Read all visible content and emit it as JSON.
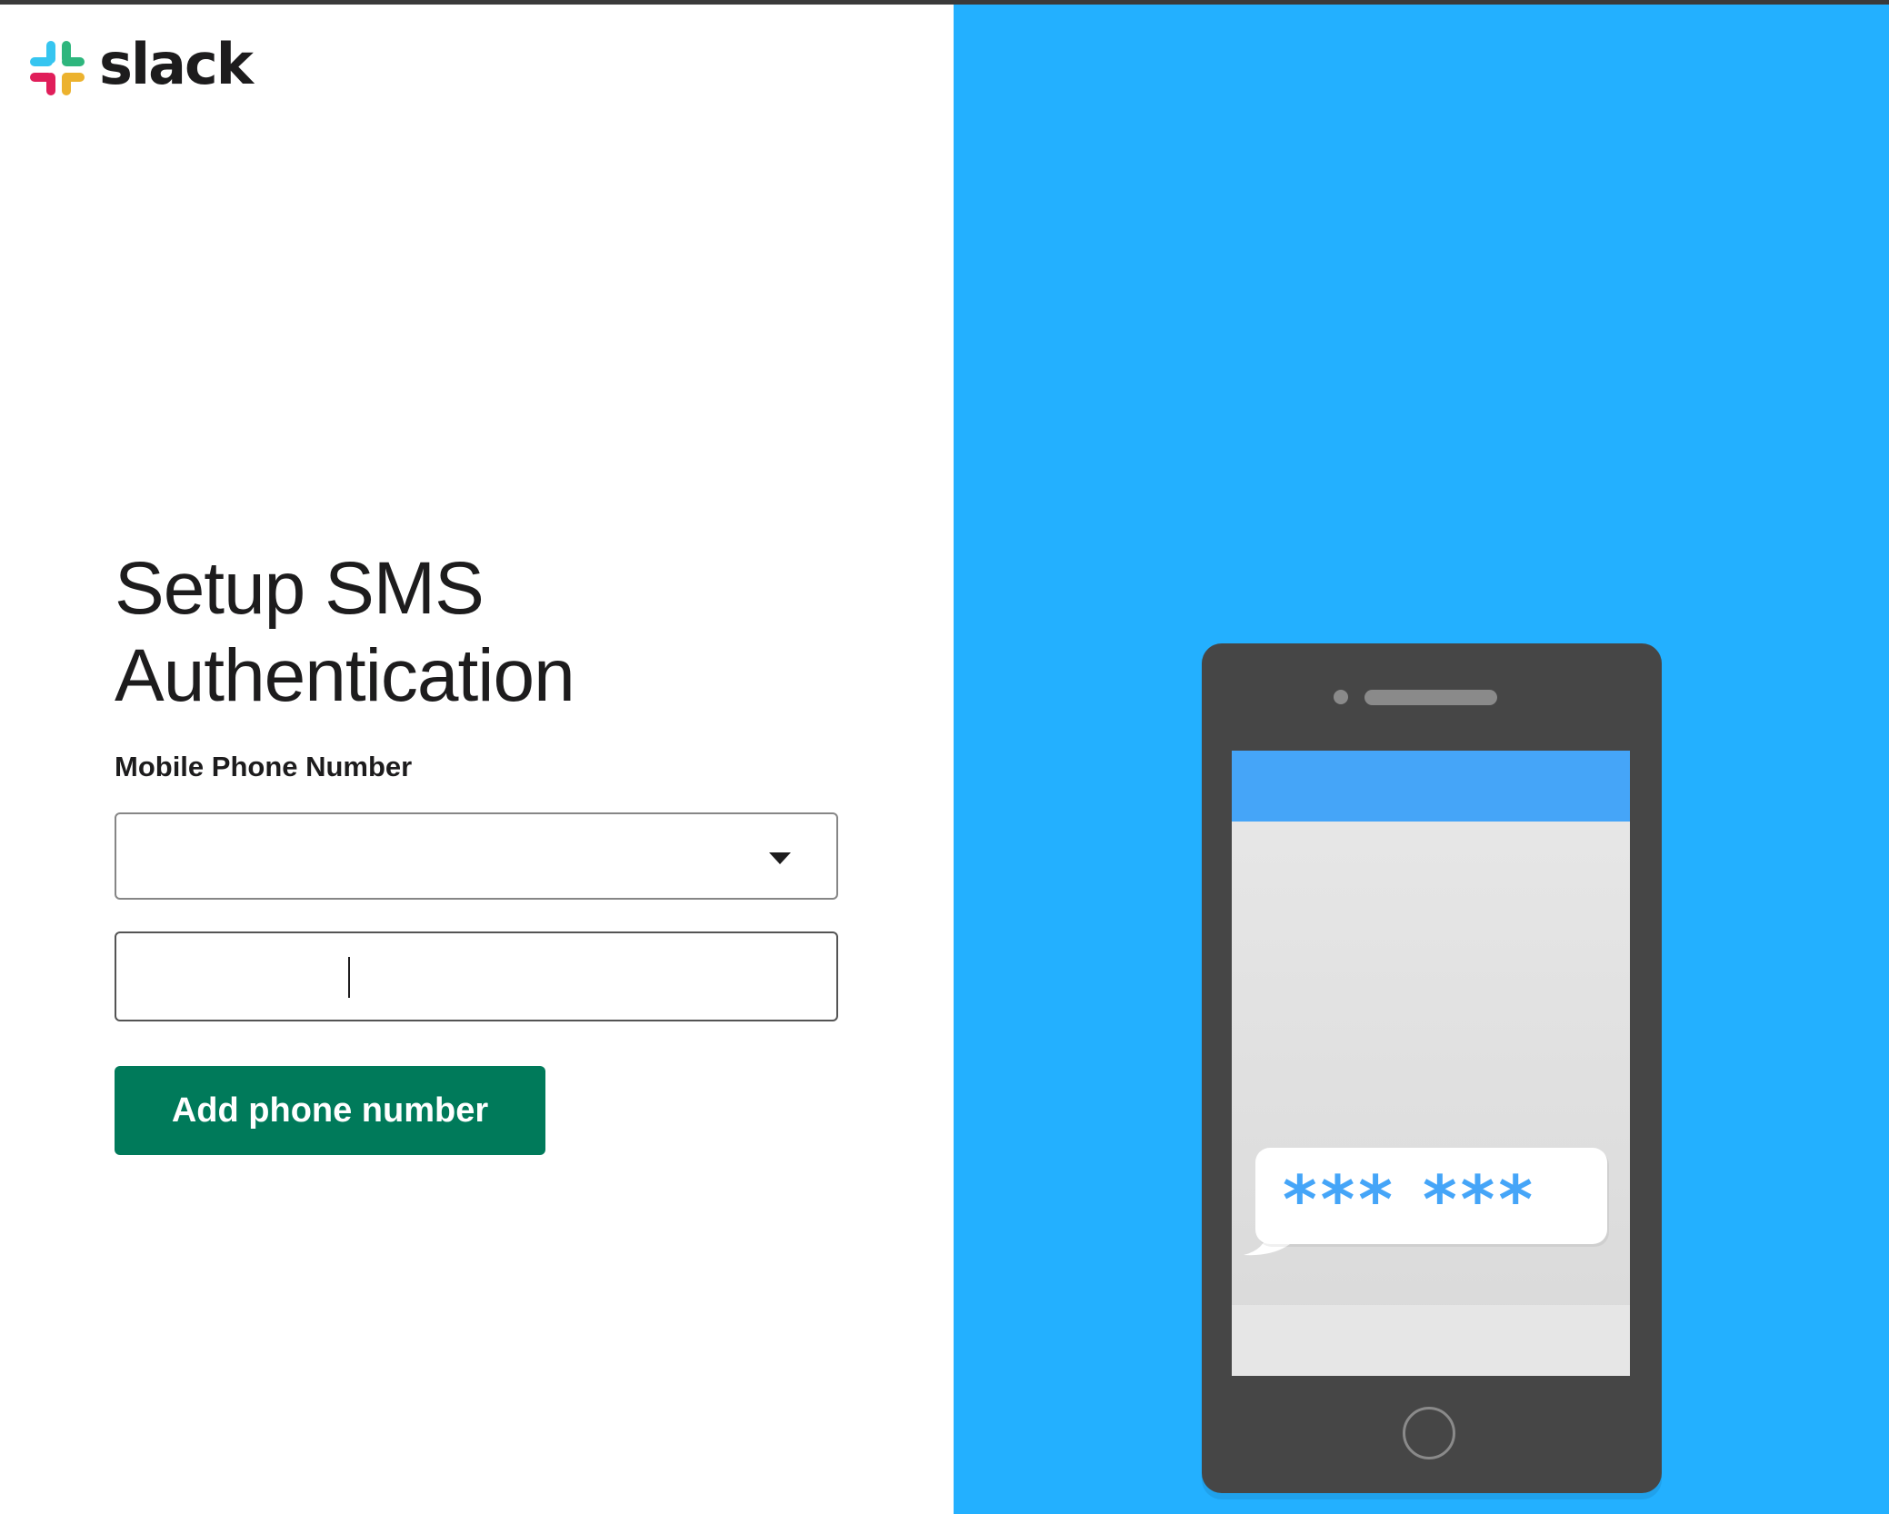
{
  "logo": {
    "wordmark": "slack",
    "icon": "slack-hash-icon"
  },
  "heading": {
    "line1": "Setup SMS",
    "line2": "Authentication"
  },
  "form": {
    "label": "Mobile Phone Number",
    "country_select": {
      "value": "",
      "icon": "chevron-down-icon"
    },
    "phone_input": {
      "value": ""
    },
    "submit_label": "Add phone number"
  },
  "illustration": {
    "sms_code": "*** ***"
  },
  "colors": {
    "brand_green": "#007a5a",
    "panel_blue": "#23b0ff",
    "screen_header": "#45a5f8"
  }
}
